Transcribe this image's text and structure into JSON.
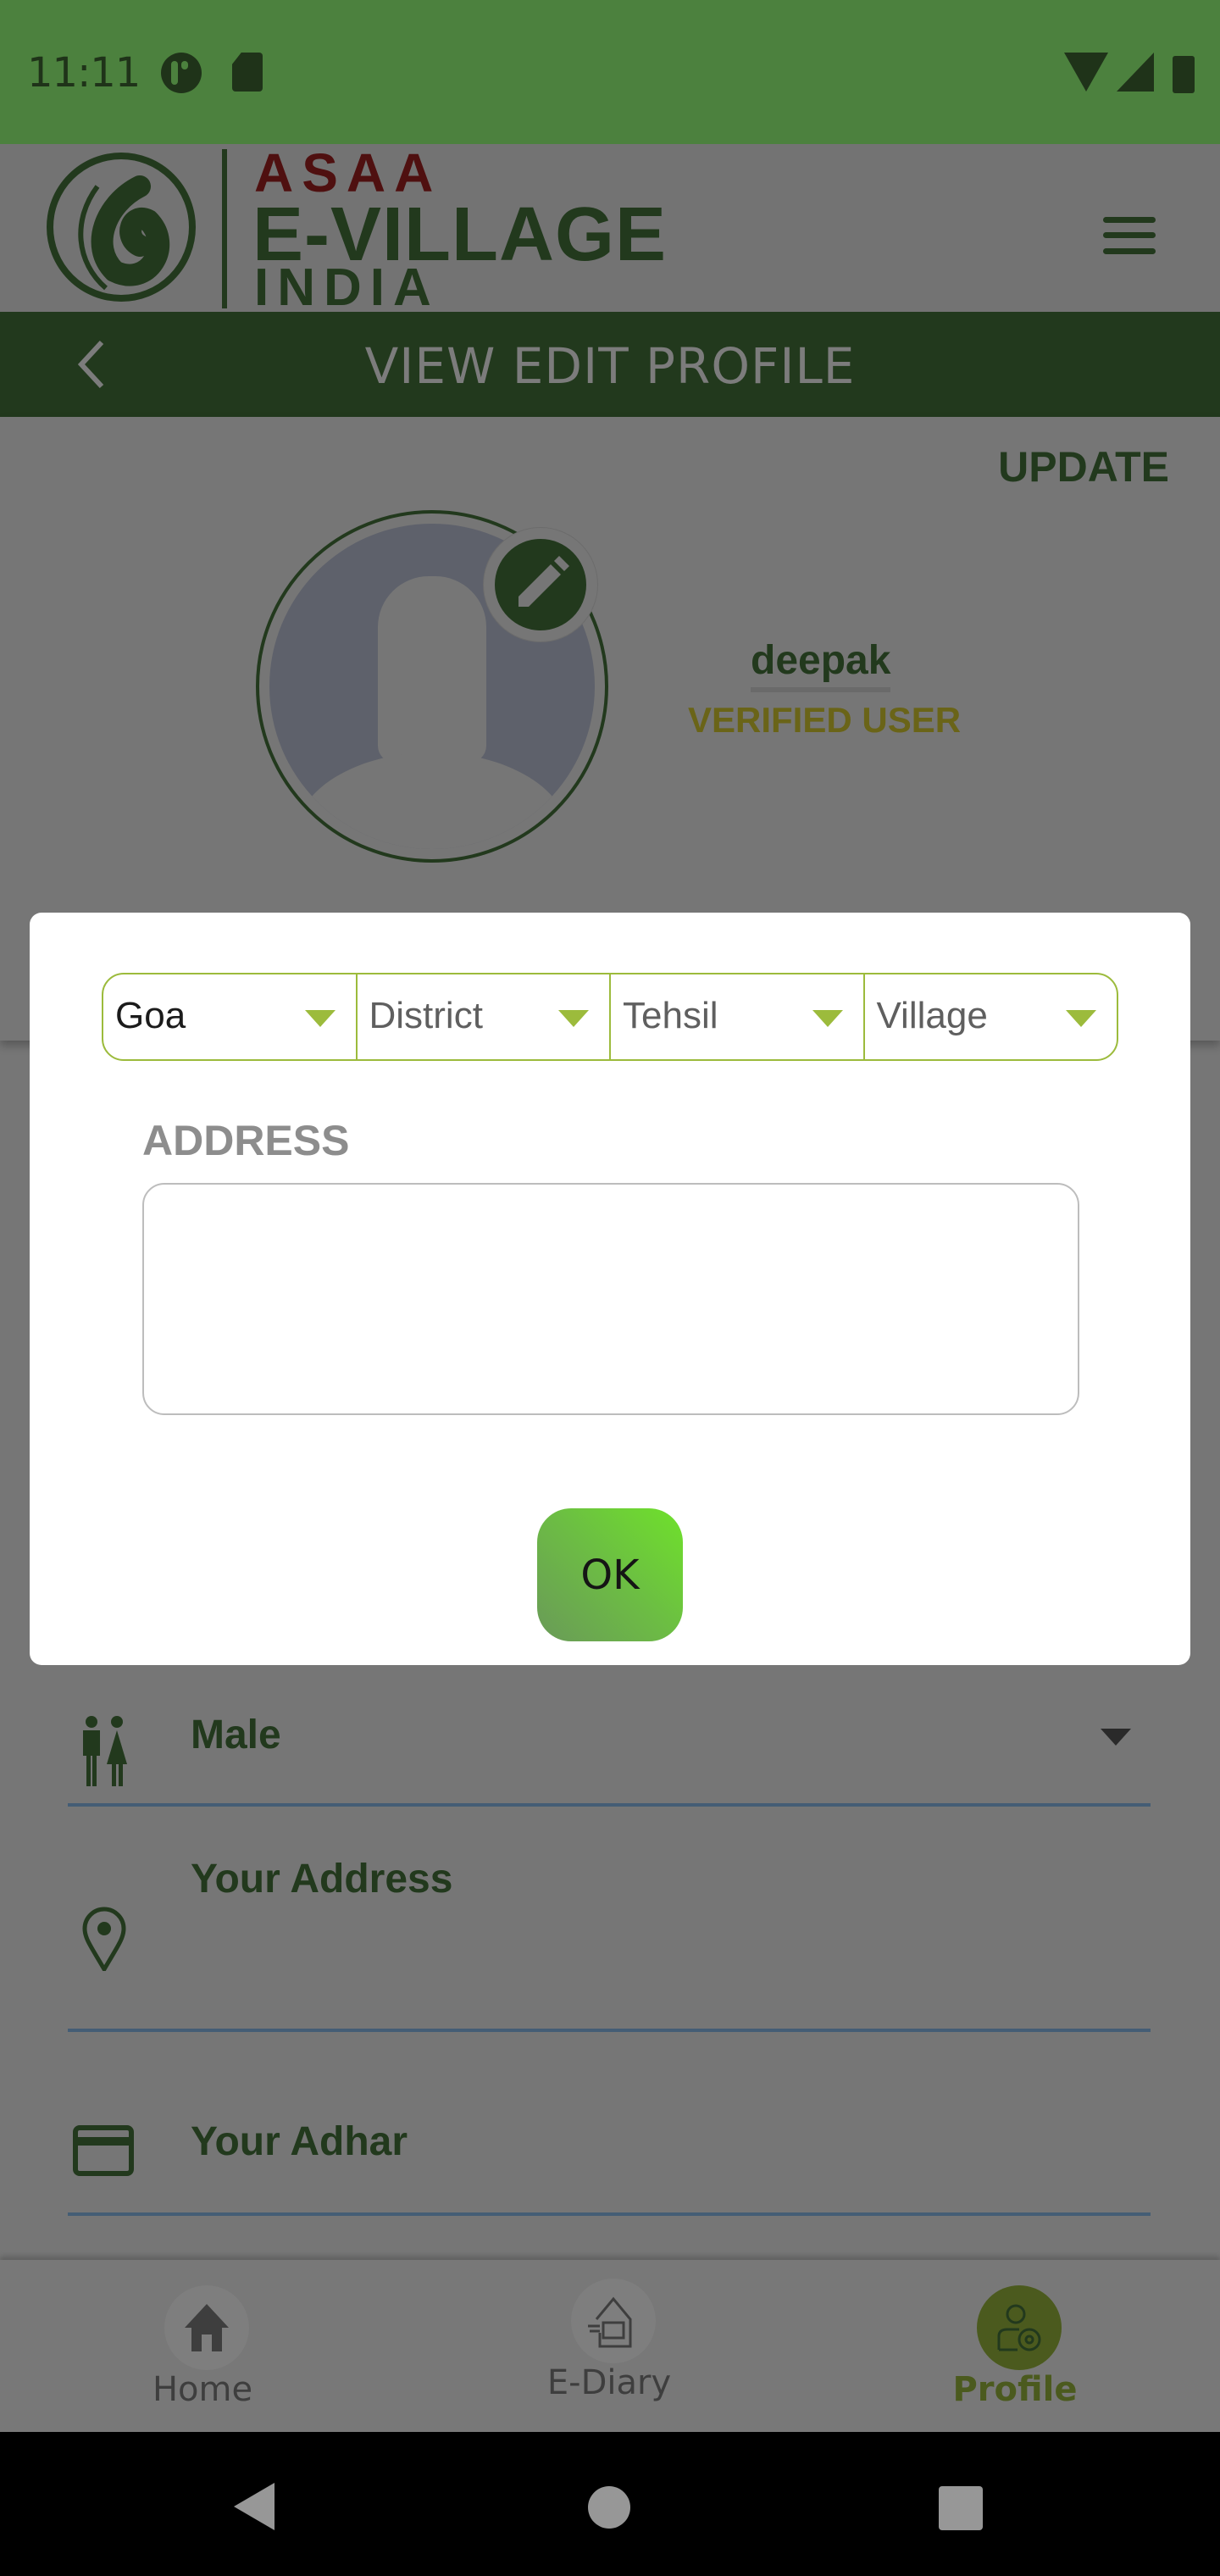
{
  "status_bar": {
    "time": "11:11",
    "left_icons": [
      "pinwheel-icon",
      "sd-card-icon"
    ],
    "right_icons": [
      "wifi-icon",
      "cell-signal-icon",
      "battery-icon"
    ]
  },
  "app_header": {
    "brand_line1": "ASAA",
    "brand_line2": "E-VILLAGE",
    "brand_line3": "INDIA",
    "menu_icon": "hamburger-menu-icon"
  },
  "title_bar": {
    "back_icon": "chevron-left-icon",
    "title": "VIEW EDIT PROFILE"
  },
  "profile": {
    "update_label": "UPDATE",
    "username": "deepak",
    "status": "VERIFIED USER",
    "edit_icon": "pencil-icon"
  },
  "dialog": {
    "dropdowns": [
      {
        "label": "Goa",
        "selected": true
      },
      {
        "label": "District",
        "selected": false
      },
      {
        "label": "Tehsil",
        "selected": false
      },
      {
        "label": "Village",
        "selected": false
      }
    ],
    "address_label": "ADDRESS",
    "address_value": "",
    "ok_label": "OK"
  },
  "form": {
    "gender": "Male",
    "address_placeholder": "Your Address",
    "adhar_placeholder": "Your Adhar"
  },
  "bottom_nav": {
    "items": [
      {
        "label": "Home",
        "icon": "home-icon",
        "active": false
      },
      {
        "label": "E-Diary",
        "icon": "diary-basket-icon",
        "active": false
      },
      {
        "label": "Profile",
        "icon": "user-settings-icon",
        "active": true
      }
    ]
  },
  "colors": {
    "brand_green": "#4c813e",
    "accent_lime": "#9cbb3c",
    "brand_red": "#8b1a1a",
    "ok_gradient_start": "#6fe12b",
    "ok_gradient_end": "#6a9a58"
  }
}
